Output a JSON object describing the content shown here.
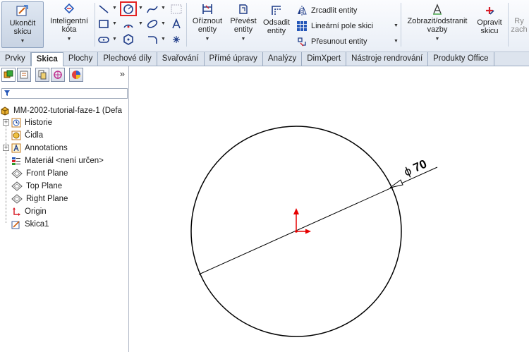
{
  "ribbon": {
    "exit_sketch": "Ukončit skicu",
    "smart_dimension": "Inteligentní kóta",
    "trim_entities": "Oříznout entity",
    "convert_entities": "Převést entity",
    "offset_entities": "Odsadit entity",
    "mirror_entities": "Zrcadlit entity",
    "linear_pattern": "Lineární pole skici",
    "move_entities": "Přesunout entity",
    "display_relations": "Zobrazit/odstranit vazby",
    "repair_sketch": "Opravit skicu",
    "quick_snaps_partial": "Ry zach"
  },
  "tabs": [
    "Prvky",
    "Skica",
    "Plochy",
    "Plechové díly",
    "Svařování",
    "Přímé úpravy",
    "Analýzy",
    "DimXpert",
    "Nástroje rendrování",
    "Produkty Office"
  ],
  "active_tab": "Skica",
  "panel": {
    "more": "»"
  },
  "tree": {
    "root": "MM-2002-tutorial-faze-1  (Defa",
    "history": "Historie",
    "sensors": "Čidla",
    "annotations": "Annotations",
    "material": "Materiál <není určen>",
    "front_plane": "Front Plane",
    "top_plane": "Top Plane",
    "right_plane": "Right Plane",
    "origin": "Origin",
    "sketch": "Skica1"
  },
  "canvas": {
    "dimension_prefix": "ϕ",
    "dimension_value": "70",
    "colors": {
      "geometry": "#000000",
      "origin": "#e60000"
    }
  }
}
